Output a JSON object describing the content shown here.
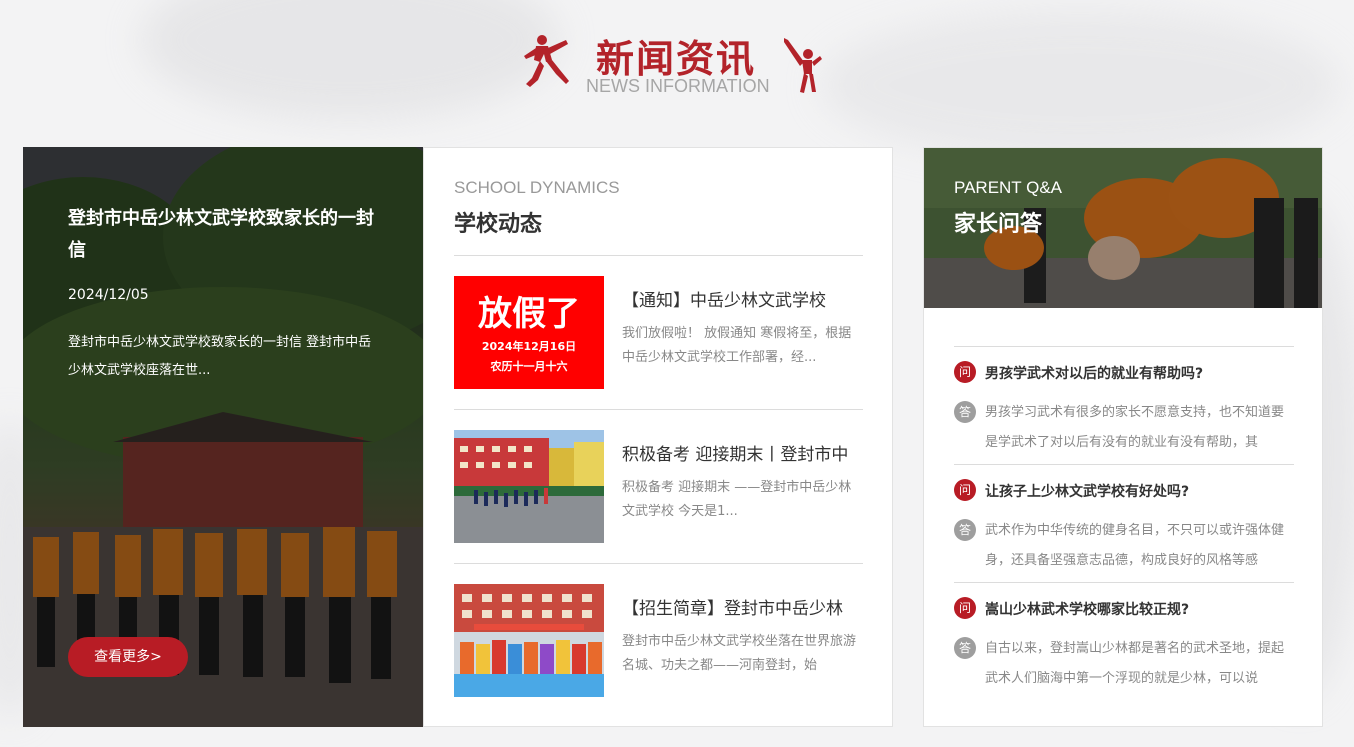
{
  "header": {
    "title": "新闻资讯",
    "subtitle": "NEWS INFORMATION",
    "icon_left": "kungfu-kick-icon",
    "icon_right": "kungfu-high-kick-icon"
  },
  "feature": {
    "title": "登封市中岳少林文武学校致家长的一封信",
    "date": "2024/12/05",
    "description": "登封市中岳少林文武学校致家长的一封信 登封市中岳少林文武学校座落在世...",
    "more_label": "查看更多>"
  },
  "dynamics": {
    "title_en": "SCHOOL DYNAMICS",
    "title_cn": "学校动态",
    "items": [
      {
        "title": "【通知】中岳少林文武学校",
        "summary": "我们放假啦！ 放假通知 寒假将至，根据中岳少林文武学校工作部署，经...",
        "thumb": {
          "headline": "放假了",
          "line1": "2024年12月16日",
          "line2": "农历十一月十六"
        }
      },
      {
        "title": "积极备考 迎接期末丨登封市中",
        "summary": "积极备考 迎接期末 ——登封市中岳少林文武学校 今天是1..."
      },
      {
        "title": "【招生简章】登封市中岳少林",
        "summary": "登封市中岳少林文武学校坐落在世界旅游名城、功夫之都——河南登封，始"
      }
    ]
  },
  "qa": {
    "title_en": "PARENT Q&A",
    "title_cn": "家长问答",
    "q_label": "问",
    "a_label": "答",
    "items": [
      {
        "question": "男孩学武术对以后的就业有帮助吗?",
        "answer": "男孩学习武术有很多的家长不愿意支持，也不知道要是学武术了对以后有没有的就业有没有帮助，其"
      },
      {
        "question": "让孩子上少林文武学校有好处吗?",
        "answer": "武术作为中华传统的健身名目，不只可以或许强体健身，还具备坚强意志品德，构成良好的风格等感"
      },
      {
        "question": "嵩山少林武术学校哪家比较正规?",
        "answer": "自古以来，登封嵩山少林都是著名的武术圣地，提起武术人们脑海中第一个浮现的就是少林，可以说"
      }
    ]
  },
  "colors": {
    "accent_red": "#b81c25",
    "title_red": "#b3232a",
    "muted_text": "#888888"
  }
}
